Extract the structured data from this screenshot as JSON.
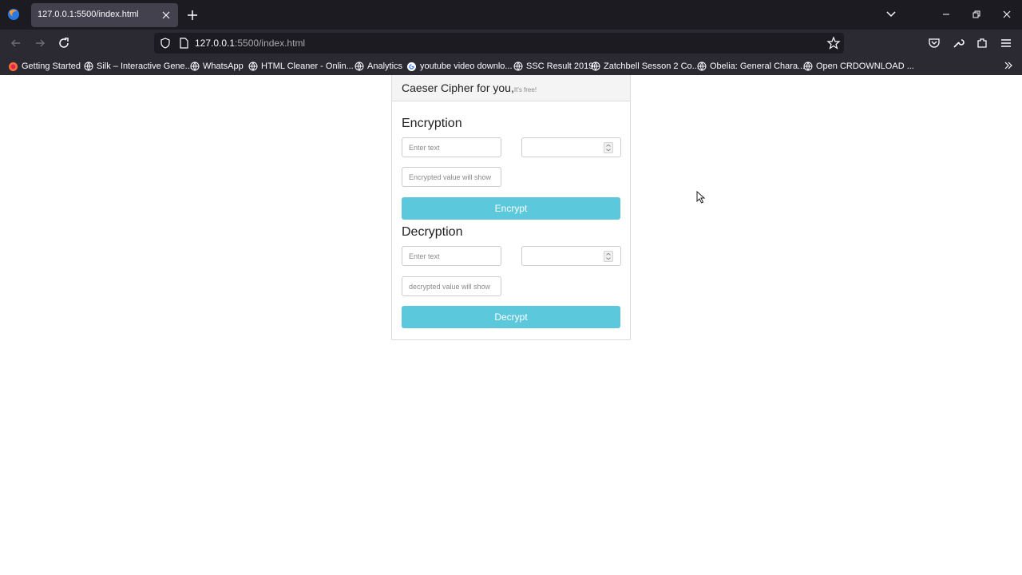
{
  "browser": {
    "tab_title": "127.0.0.1:5500/index.html",
    "url_host": "127.0.0.1",
    "url_rest": ":5500/index.html",
    "bookmarks": [
      {
        "label": "Getting Started",
        "icon": "firefox-icon"
      },
      {
        "label": "Silk – Interactive Gene...",
        "icon": "globe-icon"
      },
      {
        "label": "WhatsApp",
        "icon": "globe-icon"
      },
      {
        "label": "HTML Cleaner - Onlin...",
        "icon": "globe-icon"
      },
      {
        "label": "Analytics",
        "icon": "globe-icon"
      },
      {
        "label": "youtube video downlo...",
        "icon": "google-icon"
      },
      {
        "label": "SSC Result 2019",
        "icon": "globe-icon"
      },
      {
        "label": "Zatchbell Sesson 2 Co...",
        "icon": "globe-icon"
      },
      {
        "label": "Obelia: General Chara...",
        "icon": "globe-icon"
      },
      {
        "label": "Open CRDOWNLOAD ...",
        "icon": "globe-icon"
      }
    ]
  },
  "app": {
    "header_title": "Caeser Cipher for you,",
    "header_sub": "It's free!",
    "encryption": {
      "title": "Encryption",
      "text_placeholder": "Enter text",
      "result_placeholder": "Encrypted value will show",
      "button_label": "Encrypt"
    },
    "decryption": {
      "title": "Decryption",
      "text_placeholder": "Enter text",
      "result_placeholder": "decrypted value will show",
      "button_label": "Decrypt"
    }
  },
  "colors": {
    "button": "#5bc8dc",
    "tabstrip": "#1c1b22",
    "toolbar": "#2b2a33"
  }
}
